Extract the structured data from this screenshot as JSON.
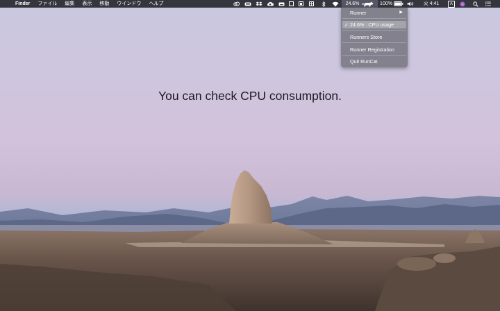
{
  "menubar": {
    "apple_glyph": "",
    "app_name": "Finder",
    "menus": [
      "ファイル",
      "編集",
      "表示",
      "移動",
      "ウインドウ",
      "ヘルプ"
    ],
    "status_icons": [
      "creative-cloud-icon",
      "line-icon",
      "dropbox-icon",
      "icloud-icon",
      "keyboard-icon",
      "square-icon",
      "window-icon",
      "grid-icon",
      "bluetooth-icon",
      "wifi-icon"
    ],
    "cpu_value": "24.6%",
    "battery_percent": "100%",
    "battery_level": 1.0,
    "time": "火 4:41",
    "input_method": "A"
  },
  "menu": {
    "items": [
      {
        "label": "Runner",
        "has_submenu": true
      },
      {
        "label": "24.6% : CPU usage",
        "checked": true,
        "highlighted": true
      },
      {
        "label": "Runners Store"
      },
      {
        "label": "Runner Registration"
      },
      {
        "label": "Quit RunCat"
      }
    ],
    "check_glyph": "✓",
    "submenu_glyph": "▶"
  },
  "headline": "You can check CPU consumption.",
  "colors": {
    "menubar": "#28282f",
    "menu_bg": "#78787f",
    "menu_highlight": "#aaaab2",
    "headline": "#1a1a1f"
  }
}
